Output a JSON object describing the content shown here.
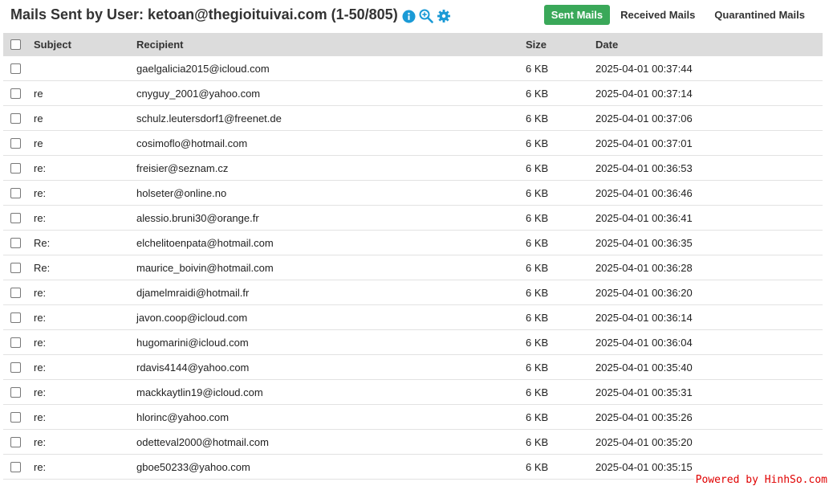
{
  "header": {
    "title": "Mails Sent by User: ketoan@thegioituivai.com (1-50/805)",
    "icons": [
      "info-icon",
      "zoom-in-icon",
      "gear-icon"
    ],
    "tabs": [
      {
        "label": "Sent Mails",
        "active": true
      },
      {
        "label": "Received Mails",
        "active": false
      },
      {
        "label": "Quarantined Mails",
        "active": false
      }
    ]
  },
  "table": {
    "columns": {
      "subject": "Subject",
      "recipient": "Recipient",
      "size": "Size",
      "date": "Date"
    },
    "rows": [
      {
        "subject": "",
        "recipient": "gaelgalicia2015@icloud.com",
        "size": "6 KB",
        "date": "2025-04-01 00:37:44"
      },
      {
        "subject": "re",
        "recipient": "cnyguy_2001@yahoo.com",
        "size": "6 KB",
        "date": "2025-04-01 00:37:14"
      },
      {
        "subject": "re",
        "recipient": "schulz.leutersdorf1@freenet.de",
        "size": "6 KB",
        "date": "2025-04-01 00:37:06"
      },
      {
        "subject": "re",
        "recipient": "cosimoflo@hotmail.com",
        "size": "6 KB",
        "date": "2025-04-01 00:37:01"
      },
      {
        "subject": "re:",
        "recipient": "freisier@seznam.cz",
        "size": "6 KB",
        "date": "2025-04-01 00:36:53"
      },
      {
        "subject": "re:",
        "recipient": "holseter@online.no",
        "size": "6 KB",
        "date": "2025-04-01 00:36:46"
      },
      {
        "subject": "re:",
        "recipient": "alessio.bruni30@orange.fr",
        "size": "6 KB",
        "date": "2025-04-01 00:36:41"
      },
      {
        "subject": "Re:",
        "recipient": "elchelitoenpata@hotmail.com",
        "size": "6 KB",
        "date": "2025-04-01 00:36:35"
      },
      {
        "subject": "Re:",
        "recipient": "maurice_boivin@hotmail.com",
        "size": "6 KB",
        "date": "2025-04-01 00:36:28"
      },
      {
        "subject": "re:",
        "recipient": "djamelmraidi@hotmail.fr",
        "size": "6 KB",
        "date": "2025-04-01 00:36:20"
      },
      {
        "subject": "re:",
        "recipient": "javon.coop@icloud.com",
        "size": "6 KB",
        "date": "2025-04-01 00:36:14"
      },
      {
        "subject": "re:",
        "recipient": "hugomarini@icloud.com",
        "size": "6 KB",
        "date": "2025-04-01 00:36:04"
      },
      {
        "subject": "re:",
        "recipient": "rdavis4144@yahoo.com",
        "size": "6 KB",
        "date": "2025-04-01 00:35:40"
      },
      {
        "subject": "re:",
        "recipient": "mackkaytlin19@icloud.com",
        "size": "6 KB",
        "date": "2025-04-01 00:35:31"
      },
      {
        "subject": "re:",
        "recipient": "hlorinc@yahoo.com",
        "size": "6 KB",
        "date": "2025-04-01 00:35:26"
      },
      {
        "subject": "re:",
        "recipient": "odetteval2000@hotmail.com",
        "size": "6 KB",
        "date": "2025-04-01 00:35:20"
      },
      {
        "subject": "re:",
        "recipient": "gboe50233@yahoo.com",
        "size": "6 KB",
        "date": "2025-04-01 00:35:15"
      }
    ]
  },
  "footer": {
    "credit": "Powered by HinhSo.com"
  },
  "colors": {
    "accent_green": "#3aa859",
    "icon_blue": "#1a9ad6",
    "header_bg": "#dcdcdc",
    "credit_red": "#e00000"
  }
}
